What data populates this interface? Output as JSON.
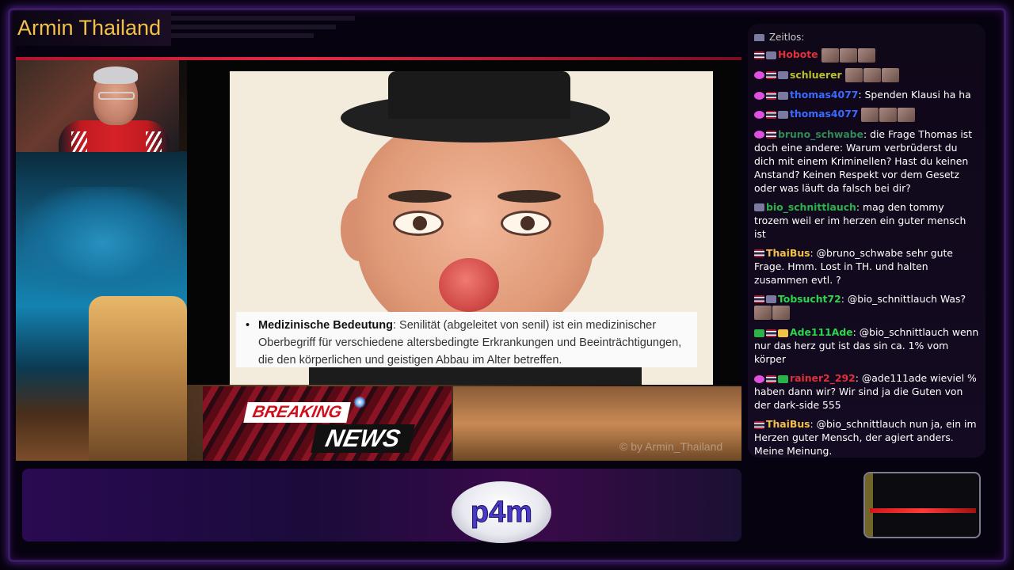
{
  "channel": {
    "title": "Armin Thailand"
  },
  "video": {
    "watermark": "© by Armin_Thailand",
    "caption_bold": "Medizinische Bedeutung",
    "caption_text": ": Senilität (abgeleitet von senil) ist ein medizinischer Oberbegriff für verschiedene altersbedingte Erkrankungen und Beeinträchtigungen, die den körperlichen und geistigen Abbau im Alter betreffen."
  },
  "breaking_news": {
    "line1": "BREAKING",
    "line2": "NEWS"
  },
  "logo": {
    "text": "p4m"
  },
  "chat": {
    "cut_line": "Zeitlos:",
    "messages": [
      {
        "user": "Hobote",
        "color": "#e0303a",
        "text": "",
        "badges": [
          "flag",
          "sub"
        ],
        "emotes": 3
      },
      {
        "user": "schluerer",
        "color": "#b8c02a",
        "text": "",
        "badges": [
          "heart",
          "flag",
          "sub"
        ],
        "emotes": 3
      },
      {
        "user": "thomas4077",
        "color": "#3a6aff",
        "text": "Spenden Klausi ha ha",
        "badges": [
          "heart",
          "flag",
          "sub"
        ],
        "emotes": 0
      },
      {
        "user": "thomas4077",
        "color": "#3a6aff",
        "text": "",
        "badges": [
          "heart",
          "flag",
          "sub"
        ],
        "emotes": 3
      },
      {
        "user": "bruno_schwabe",
        "color": "#2e8a57",
        "text": "die Frage Thomas ist doch eine andere: Warum verbrüderst du dich mit einem Kriminellen? Hast du keinen Anstand? Keinen Respekt vor dem Gesetz oder was läuft da falsch bei dir?",
        "badges": [
          "heart",
          "flag"
        ],
        "emotes": 0
      },
      {
        "user": "bio_schnittlauch",
        "color": "#2bb34a",
        "text": "mag den tommy trozem weil er im herzen ein guter mensch ist",
        "badges": [
          "sub"
        ],
        "emotes": 0
      },
      {
        "user": "ThaiBus",
        "color": "#f2c14a",
        "text": "@bruno_schwabe sehr gute Frage. Hmm. Lost in TH. und halten zusammen evtl. ?",
        "badges": [
          "flag"
        ],
        "emotes": 0
      },
      {
        "user": "Tobsucht72",
        "color": "#2bd64a",
        "text": "@bio_schnittlauch Was?",
        "badges": [
          "flag",
          "sub"
        ],
        "emotes": 2
      },
      {
        "user": "Ade111Ade",
        "color": "#2bd64a",
        "text": "@bio_schnittlauch wenn nur das herz gut ist das sin ca. 1% vom körper",
        "badges": [
          "green",
          "flag",
          "crown"
        ],
        "emotes": 0
      },
      {
        "user": "rainer2_292",
        "color": "#e0303a",
        "text": "@ade111ade wieviel % haben dann wir? Wir sind ja die Guten von der dark-side 555",
        "badges": [
          "heart",
          "flag",
          "green"
        ],
        "emotes": 0
      },
      {
        "user": "ThaiBus",
        "color": "#f2c14a",
        "text": "@bio_schnittlauch nun ja, ein im Herzen guter Mensch, der agiert anders. Meine Meinung.",
        "badges": [
          "flag"
        ],
        "emotes": 0
      }
    ]
  }
}
